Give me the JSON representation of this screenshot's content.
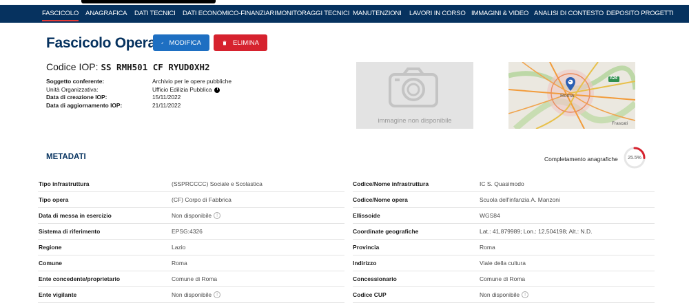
{
  "nav": {
    "items": [
      "FASCICOLO",
      "ANAGRAFICA",
      "DATI TECNICI",
      "DATI ECONOMICO-FINANZIARI",
      "MONITORAGGI TECNICI",
      "MANUTENZIONI",
      "LAVORI IN CORSO",
      "IMMAGINI & VIDEO",
      "ANALISI DI CONTESTO",
      "DEPOSITO PROGETTI"
    ],
    "active": "FASCICOLO"
  },
  "header": {
    "title": "Fascicolo Opera",
    "edit_label": "MODIFICA",
    "delete_label": "ELIMINA",
    "iop_label": "Codice IOP:",
    "iop_value": "SS RMH501 CF RYUD0XH2"
  },
  "info": [
    {
      "label": "Soggetto conferente:",
      "value": "Archivio per le opere pubbliche",
      "bold": true
    },
    {
      "label": "Unità Organizzativa:",
      "value": "Ufficio Edilizia Pubblica",
      "bold": false,
      "info": true
    },
    {
      "label": "Data di creazione IOP:",
      "value": "15/11/2022",
      "bold": true
    },
    {
      "label": "Data di aggiornamento IOP:",
      "value": "21/11/2022",
      "bold": true
    }
  ],
  "image_placeholder": "immagine non disponibile",
  "map": {
    "marker": "C",
    "road": "A24",
    "city": "Roma",
    "area": "Frascati"
  },
  "metadata": {
    "title": "METADATI",
    "completion_label": "Completamento anagrafiche",
    "completion_value": "25.5%",
    "completion_fraction": 0.255,
    "left": [
      {
        "k": "Tipo infrastruttura",
        "v": "(SSPRCCCC) Sociale e Scolastica"
      },
      {
        "k": "Tipo opera",
        "v": "(CF) Corpo di Fabbrica"
      },
      {
        "k": "Data di messa in esercizio",
        "v": "Non disponibile",
        "help": true
      },
      {
        "k": "Sistema di riferimento",
        "v": "EPSG:4326"
      },
      {
        "k": "Regione",
        "v": "Lazio"
      },
      {
        "k": "Comune",
        "v": "Roma"
      },
      {
        "k": "Ente concedente/proprietario",
        "v": "Comune di Roma"
      },
      {
        "k": "Ente vigilante",
        "v": "Non disponibile",
        "help": true
      }
    ],
    "right": [
      {
        "k": "Codice/Nome infrastruttura",
        "v": "IC S. Quasimodo"
      },
      {
        "k": "Codice/Nome opera",
        "v": "Scuola dell'infanzia A. Manzoni"
      },
      {
        "k": "Ellissoide",
        "v": "WGS84"
      },
      {
        "k": "Coordinate geografiche",
        "v": "Lat.: 41,879989; Lon.: 12,504198; Alt.: N.D."
      },
      {
        "k": "Provincia",
        "v": "Roma"
      },
      {
        "k": "Indirizzo",
        "v": "Viale della cultura"
      },
      {
        "k": "Concessionario",
        "v": "Comune di Roma"
      },
      {
        "k": "Codice CUP",
        "v": "Non disponibile",
        "help": true
      }
    ]
  },
  "colors": {
    "navy": "#06325f",
    "blue": "#1e6fc2",
    "red": "#d6222e"
  }
}
